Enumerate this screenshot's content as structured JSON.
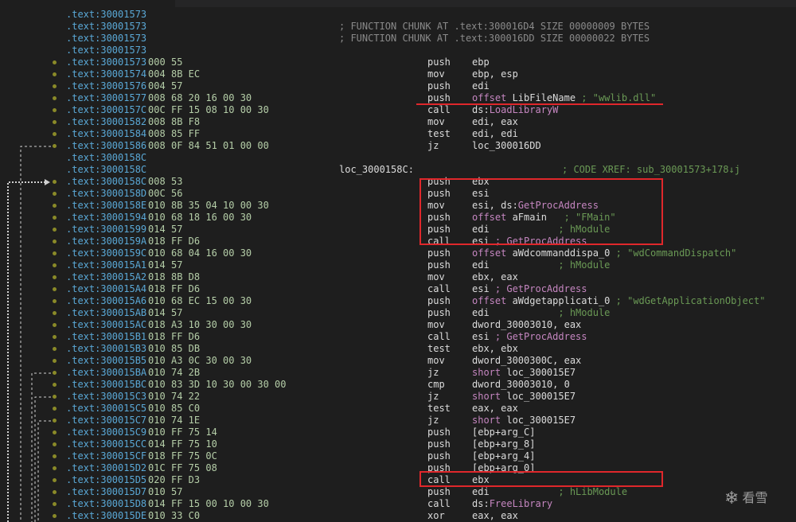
{
  "watermark": {
    "icon": "snowflake-icon",
    "text": "看雪"
  },
  "colors": {
    "highlight": "#e0272b",
    "address": "#5aa8d6",
    "comment": "#6a9955",
    "import": "#c586c0"
  },
  "lines": [
    {
      "addr": ".text:30001573"
    },
    {
      "addr": ".text:30001573",
      "chunk": "; FUNCTION CHUNK AT .text:300016D4 SIZE 00000009 BYTES"
    },
    {
      "addr": ".text:30001573",
      "chunk": "; FUNCTION CHUNK AT .text:300016DD SIZE 00000022 BYTES"
    },
    {
      "addr": ".text:30001573"
    },
    {
      "addr": ".text:30001573",
      "sp": "000",
      "bytes": "55",
      "mnem": "push",
      "ops": [
        {
          "t": "ebp"
        }
      ]
    },
    {
      "addr": ".text:30001574",
      "sp": "004",
      "bytes": "8B EC",
      "mnem": "mov",
      "ops": [
        {
          "t": "ebp, esp"
        }
      ]
    },
    {
      "addr": ".text:30001576",
      "sp": "004",
      "bytes": "57",
      "mnem": "push",
      "ops": [
        {
          "t": "edi"
        }
      ]
    },
    {
      "addr": ".text:30001577",
      "sp": "008",
      "bytes": "68 20 16 00 30",
      "mnem": "push",
      "ops": [
        {
          "t": "offset",
          "c": "kw"
        },
        {
          "t": " LibFileName "
        },
        {
          "t": "; \"wwlib.dll\"",
          "c": "cmt"
        }
      ]
    },
    {
      "addr": ".text:3000157C",
      "sp": "00C",
      "bytes": "FF 15 08 10 00 30",
      "mnem": "call",
      "ops": [
        {
          "t": "ds:"
        },
        {
          "t": "LoadLibraryW",
          "c": "fn"
        }
      ]
    },
    {
      "addr": ".text:30001582",
      "sp": "008",
      "bytes": "8B F8",
      "mnem": "mov",
      "ops": [
        {
          "t": "edi, eax"
        }
      ]
    },
    {
      "addr": ".text:30001584",
      "sp": "008",
      "bytes": "85 FF",
      "mnem": "test",
      "ops": [
        {
          "t": "edi, edi"
        }
      ]
    },
    {
      "addr": ".text:30001586",
      "sp": "008",
      "bytes": "0F 84 51 01 00 00",
      "mnem": "jz",
      "ops": [
        {
          "t": "loc_300016DD"
        }
      ]
    },
    {
      "addr": ".text:3000158C"
    },
    {
      "addr": ".text:3000158C",
      "label": "loc_3000158C:",
      "xref": "; CODE XREF: sub_30001573+178↓j"
    },
    {
      "addr": ".text:3000158C",
      "sp": "008",
      "bytes": "53",
      "mnem": "push",
      "ops": [
        {
          "t": "ebx"
        }
      ]
    },
    {
      "addr": ".text:3000158D",
      "sp": "00C",
      "bytes": "56",
      "mnem": "push",
      "ops": [
        {
          "t": "esi"
        }
      ]
    },
    {
      "addr": ".text:3000158E",
      "sp": "010",
      "bytes": "8B 35 04 10 00 30",
      "mnem": "mov",
      "ops": [
        {
          "t": "esi, ds:"
        },
        {
          "t": "GetProcAddress",
          "c": "fn"
        }
      ]
    },
    {
      "addr": ".text:30001594",
      "sp": "010",
      "bytes": "68 18 16 00 30",
      "mnem": "push",
      "ops": [
        {
          "t": "offset",
          "c": "kw"
        },
        {
          "t": " aFmain   "
        },
        {
          "t": "; \"FMain\"",
          "c": "cmt"
        }
      ]
    },
    {
      "addr": ".text:30001599",
      "sp": "014",
      "bytes": "57",
      "mnem": "push",
      "ops": [
        {
          "t": "edi            "
        },
        {
          "t": "; hModule",
          "c": "cmt"
        }
      ]
    },
    {
      "addr": ".text:3000159A",
      "sp": "018",
      "bytes": "FF D6",
      "mnem": "call",
      "ops": [
        {
          "t": "esi "
        },
        {
          "t": "; GetProcAddress",
          "c": "fn"
        }
      ]
    },
    {
      "addr": ".text:3000159C",
      "sp": "010",
      "bytes": "68 04 16 00 30",
      "mnem": "push",
      "ops": [
        {
          "t": "offset",
          "c": "kw"
        },
        {
          "t": " aWdcommanddispa_0 "
        },
        {
          "t": "; \"wdCommandDispatch\"",
          "c": "cmt"
        }
      ]
    },
    {
      "addr": ".text:300015A1",
      "sp": "014",
      "bytes": "57",
      "mnem": "push",
      "ops": [
        {
          "t": "edi            "
        },
        {
          "t": "; hModule",
          "c": "cmt"
        }
      ]
    },
    {
      "addr": ".text:300015A2",
      "sp": "018",
      "bytes": "8B D8",
      "mnem": "mov",
      "ops": [
        {
          "t": "ebx, eax"
        }
      ]
    },
    {
      "addr": ".text:300015A4",
      "sp": "018",
      "bytes": "FF D6",
      "mnem": "call",
      "ops": [
        {
          "t": "esi "
        },
        {
          "t": "; GetProcAddress",
          "c": "fn"
        }
      ]
    },
    {
      "addr": ".text:300015A6",
      "sp": "010",
      "bytes": "68 EC 15 00 30",
      "mnem": "push",
      "ops": [
        {
          "t": "offset",
          "c": "kw"
        },
        {
          "t": " aWdgetapplicati_0 "
        },
        {
          "t": "; \"wdGetApplicationObject\"",
          "c": "cmt"
        }
      ]
    },
    {
      "addr": ".text:300015AB",
      "sp": "014",
      "bytes": "57",
      "mnem": "push",
      "ops": [
        {
          "t": "edi            "
        },
        {
          "t": "; hModule",
          "c": "cmt"
        }
      ]
    },
    {
      "addr": ".text:300015AC",
      "sp": "018",
      "bytes": "A3 10 30 00 30",
      "mnem": "mov",
      "ops": [
        {
          "t": "dword_30003010, eax"
        }
      ]
    },
    {
      "addr": ".text:300015B1",
      "sp": "018",
      "bytes": "FF D6",
      "mnem": "call",
      "ops": [
        {
          "t": "esi "
        },
        {
          "t": "; GetProcAddress",
          "c": "fn"
        }
      ]
    },
    {
      "addr": ".text:300015B3",
      "sp": "010",
      "bytes": "85 DB",
      "mnem": "test",
      "ops": [
        {
          "t": "ebx, ebx"
        }
      ]
    },
    {
      "addr": ".text:300015B5",
      "sp": "010",
      "bytes": "A3 0C 30 00 30",
      "mnem": "mov",
      "ops": [
        {
          "t": "dword_3000300C, eax"
        }
      ]
    },
    {
      "addr": ".text:300015BA",
      "sp": "010",
      "bytes": "74 2B",
      "mnem": "jz",
      "ops": [
        {
          "t": "short",
          "c": "kw"
        },
        {
          "t": " loc_300015E7"
        }
      ]
    },
    {
      "addr": ".text:300015BC",
      "sp": "010",
      "bytes": "83 3D 10 30 00 30 00",
      "mnem": "cmp",
      "ops": [
        {
          "t": "dword_30003010, 0"
        }
      ]
    },
    {
      "addr": ".text:300015C3",
      "sp": "010",
      "bytes": "74 22",
      "mnem": "jz",
      "ops": [
        {
          "t": "short",
          "c": "kw"
        },
        {
          "t": " loc_300015E7"
        }
      ]
    },
    {
      "addr": ".text:300015C5",
      "sp": "010",
      "bytes": "85 C0",
      "mnem": "test",
      "ops": [
        {
          "t": "eax, eax"
        }
      ]
    },
    {
      "addr": ".text:300015C7",
      "sp": "010",
      "bytes": "74 1E",
      "mnem": "jz",
      "ops": [
        {
          "t": "short",
          "c": "kw"
        },
        {
          "t": " loc_300015E7"
        }
      ]
    },
    {
      "addr": ".text:300015C9",
      "sp": "010",
      "bytes": "FF 75 14",
      "mnem": "push",
      "ops": [
        {
          "t": "[ebp+arg_C]"
        }
      ]
    },
    {
      "addr": ".text:300015CC",
      "sp": "014",
      "bytes": "FF 75 10",
      "mnem": "push",
      "ops": [
        {
          "t": "[ebp+arg_8]"
        }
      ]
    },
    {
      "addr": ".text:300015CF",
      "sp": "018",
      "bytes": "FF 75 0C",
      "mnem": "push",
      "ops": [
        {
          "t": "[ebp+arg_4]"
        }
      ]
    },
    {
      "addr": ".text:300015D2",
      "sp": "01C",
      "bytes": "FF 75 08",
      "mnem": "push",
      "ops": [
        {
          "t": "[ebp+arg_0]"
        }
      ]
    },
    {
      "addr": ".text:300015D5",
      "sp": "020",
      "bytes": "FF D3",
      "mnem": "call",
      "ops": [
        {
          "t": "ebx"
        }
      ]
    },
    {
      "addr": ".text:300015D7",
      "sp": "010",
      "bytes": "57",
      "mnem": "push",
      "ops": [
        {
          "t": "edi            "
        },
        {
          "t": "; hLibModule",
          "c": "cmt"
        }
      ]
    },
    {
      "addr": ".text:300015D8",
      "sp": "014",
      "bytes": "FF 15 00 10 00 30",
      "mnem": "call",
      "ops": [
        {
          "t": "ds:"
        },
        {
          "t": "FreeLibrary",
          "c": "fn"
        }
      ]
    },
    {
      "addr": ".text:300015DE",
      "sp": "010",
      "bytes": "33 C0",
      "mnem": "xor",
      "ops": [
        {
          "t": "eax, eax"
        }
      ]
    }
  ]
}
